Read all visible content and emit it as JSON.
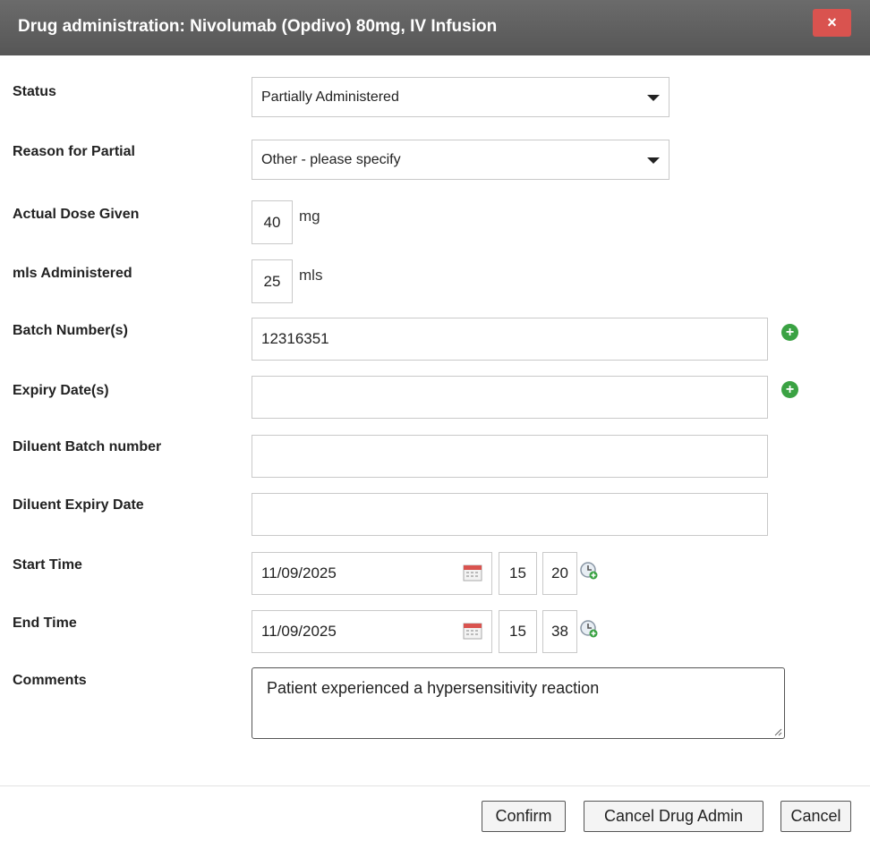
{
  "dialog": {
    "title": "Drug administration: Nivolumab (Opdivo) 80mg, IV Infusion",
    "close_icon": "×"
  },
  "form": {
    "status": {
      "label": "Status",
      "value": "Partially Administered"
    },
    "reason": {
      "label": "Reason for Partial",
      "value": "Other - please specify"
    },
    "dose": {
      "label": "Actual Dose Given",
      "value": "40",
      "unit": "mg"
    },
    "mls": {
      "label": "mls Administered",
      "value": "25",
      "unit": "mls"
    },
    "batch": {
      "label": "Batch Number(s)",
      "value": "12316351",
      "add_icon": "plus-circle-icon"
    },
    "expiry": {
      "label": "Expiry Date(s)",
      "value": "",
      "add_icon": "plus-circle-icon"
    },
    "diluent_batch": {
      "label": "Diluent Batch number",
      "value": ""
    },
    "diluent_expiry": {
      "label": "Diluent Expiry Date",
      "value": ""
    },
    "start_time": {
      "label": "Start Time",
      "date": "11/09/2025",
      "hour": "15",
      "minute": "20"
    },
    "end_time": {
      "label": "End Time",
      "date": "11/09/2025",
      "hour": "15",
      "minute": "38"
    },
    "comments": {
      "label": "Comments",
      "value": "Patient experienced a hypersensitivity reaction"
    }
  },
  "footer": {
    "confirm_label": "Confirm",
    "cancel_admin_label": "Cancel Drug Admin",
    "cancel_label": "Cancel"
  },
  "colors": {
    "titlebar": "#5f5f5f",
    "close_button": "#d9534f",
    "add_icon": "#3aa243"
  }
}
